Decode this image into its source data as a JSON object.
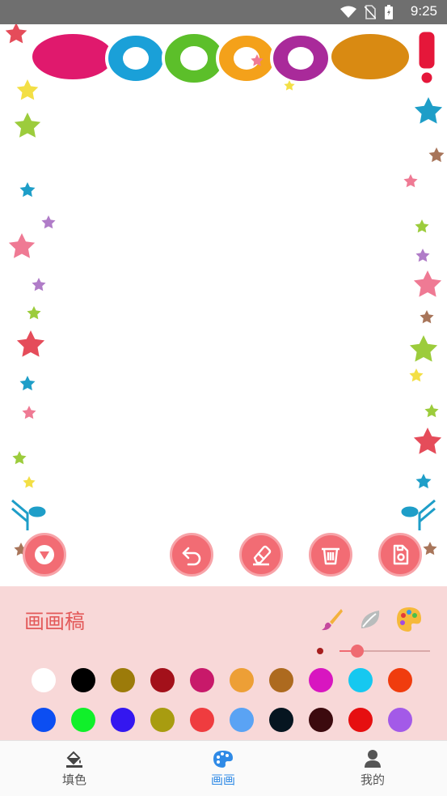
{
  "status_bar": {
    "time": "9:25"
  },
  "canvas": {
    "frame_banner_text": "WOOOOW!",
    "tools": {
      "collapse_icon": "triangle-down-icon",
      "undo_icon": "undo-icon",
      "eraser_icon": "eraser-icon",
      "clear_icon": "trash-icon",
      "save_icon": "save-icon"
    }
  },
  "panel": {
    "title": "画画稿",
    "brush_icon": "brush-icon",
    "leaf_icon": "leaf-icon",
    "palette_icon": "palette-icon",
    "brush_size_fraction": 0.2,
    "colors_row1": [
      "#ffffff",
      "#000000",
      "#9c7b0a",
      "#a3101a",
      "#c8196a",
      "#ed9f36",
      "#ad6a1f",
      "#d816c0",
      "#16c8f0",
      "#f03c0e"
    ],
    "colors_row2": [
      "#0c4ef2",
      "#10f02a",
      "#3417f0",
      "#a89c10",
      "#ef3c3f",
      "#5aa3f4",
      "#061520",
      "#3c0a0e",
      "#e60f10",
      "#a35ae8"
    ]
  },
  "bottom_nav": {
    "items": [
      {
        "label": "填色",
        "icon": "paint-bucket-icon",
        "active": false
      },
      {
        "label": "画画",
        "icon": "palette-icon",
        "active": true
      },
      {
        "label": "我的",
        "icon": "person-icon",
        "active": false
      }
    ]
  },
  "colors": {
    "accent": "#f26c74",
    "panel_bg": "#f8d8d8",
    "active_nav": "#2f8ae6"
  }
}
